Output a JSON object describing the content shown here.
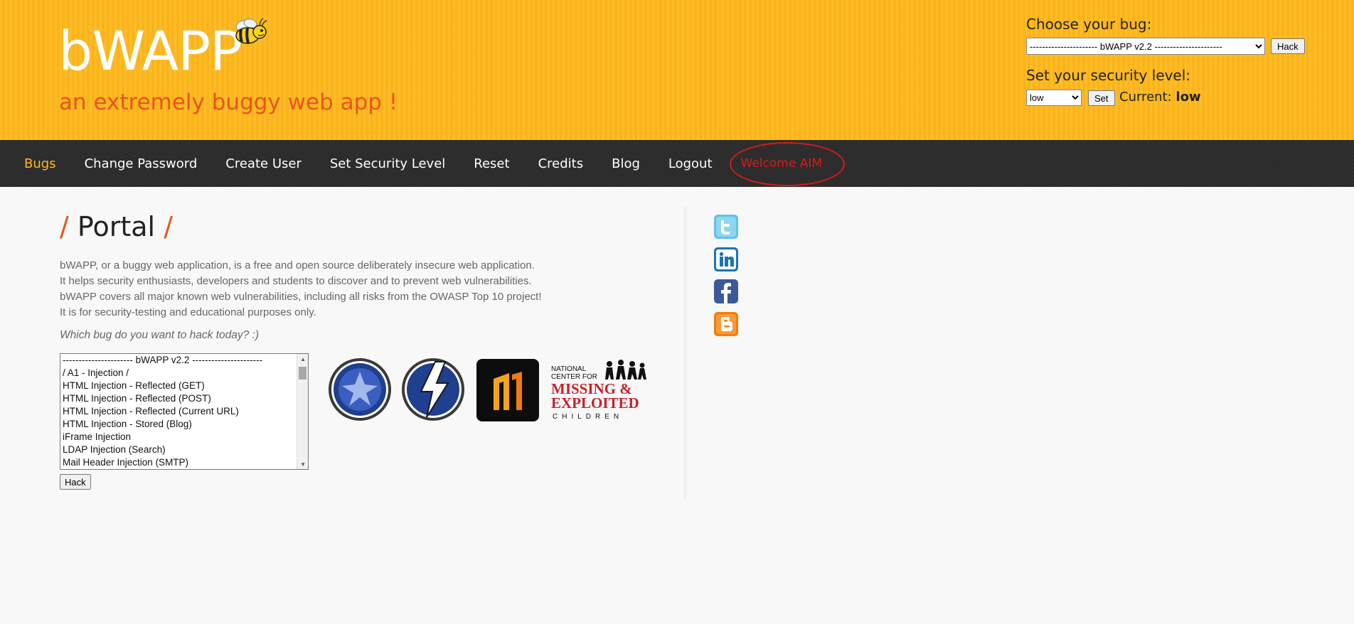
{
  "header": {
    "logo": "bWAPP",
    "tagline": "an extremely buggy web app !",
    "choose_bug_label": "Choose your bug:",
    "bug_select_value": "---------------------- bWAPP v2.2 ----------------------",
    "hack_label": "Hack",
    "security_label": "Set your security level:",
    "security_value": "low",
    "set_label": "Set",
    "current_label": "Current:",
    "current_value": "low"
  },
  "nav": {
    "items": [
      "Bugs",
      "Change Password",
      "Create User",
      "Set Security Level",
      "Reset",
      "Credits",
      "Blog",
      "Logout"
    ],
    "welcome": "Welcome AIM"
  },
  "main": {
    "title": "Portal",
    "slash": "/",
    "intro": [
      "bWAPP, or a buggy web application, is a free and open source deliberately insecure web application.",
      "It helps security enthusiasts, developers and students to discover and to prevent web vulnerabilities.",
      "bWAPP covers all major known web vulnerabilities, including all risks from the OWASP Top 10 project!",
      "It is for security-testing and educational purposes only."
    ],
    "question": "Which bug do you want to hack today? :)",
    "bug_options": [
      "---------------------- bWAPP v2.2 ----------------------",
      "/ A1 - Injection /",
      "HTML Injection - Reflected (GET)",
      "HTML Injection - Reflected (POST)",
      "HTML Injection - Reflected (Current URL)",
      "HTML Injection - Stored (Blog)",
      "iFrame Injection",
      "LDAP Injection (Search)",
      "Mail Header Injection (SMTP)"
    ],
    "hack_label": "Hack",
    "logos": {
      "ncmec_line1": "NATIONAL",
      "ncmec_line2": "CENTER FOR",
      "ncmec_line3": "MISSING &",
      "ncmec_line4": "EXPLOITED",
      "ncmec_line5": "CHILDREN"
    }
  },
  "social": [
    {
      "icon": "twitter-icon",
      "color": "#5ec2e9"
    },
    {
      "icon": "linkedin-icon",
      "color": "#1b75ae"
    },
    {
      "icon": "facebook-icon",
      "color": "#3b5998"
    },
    {
      "icon": "blogger-icon",
      "color": "#f57d00"
    }
  ],
  "colors": {
    "header": "#ffb81c",
    "accent": "#e8551a",
    "nav": "#2c2c2c",
    "welcome": "#d71b1b"
  }
}
